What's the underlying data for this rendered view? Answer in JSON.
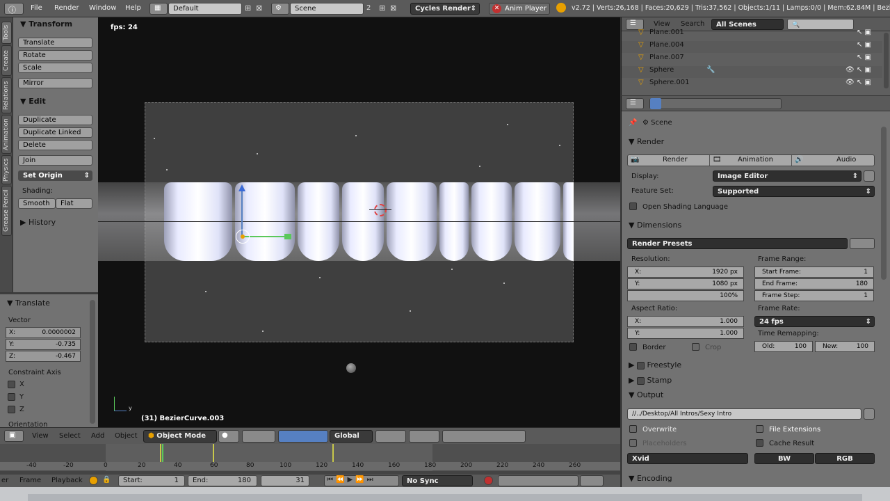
{
  "topbar": {
    "menus": [
      "File",
      "Render",
      "Window",
      "Help"
    ],
    "screen_layout": "Default",
    "scene": "Scene",
    "scene_count": "2",
    "engine": "Cycles Render",
    "anim_player": "Anim Player",
    "stats": "v2.72 | Verts:26,168 | Faces:20,629 | Tris:37,562 | Objects:1/11 | Lamps:0/0 | Mem:62.84M | BezierC"
  },
  "tabs": [
    "Tools",
    "Create",
    "Relations",
    "Animation",
    "Physics",
    "Grease Pencil"
  ],
  "tool_panel": {
    "transform": {
      "title": "Transform",
      "buttons": [
        "Translate",
        "Rotate",
        "Scale"
      ],
      "mirror": "Mirror"
    },
    "edit": {
      "title": "Edit",
      "buttons": [
        "Duplicate",
        "Duplicate Linked",
        "Delete"
      ],
      "join": "Join",
      "set_origin": "Set Origin",
      "shading_label": "Shading:",
      "smooth": "Smooth",
      "flat": "Flat"
    },
    "history": "History"
  },
  "operator_panel": {
    "title": "Translate",
    "vector_label": "Vector",
    "x_label": "X:",
    "x_value": "0.0000002",
    "y_label": "Y:",
    "y_value": "-0.735",
    "z_label": "Z:",
    "z_value": "-0.467",
    "constraint_label": "Constraint Axis",
    "axes": [
      "X",
      "Y",
      "Z"
    ],
    "orientation": "Orientation"
  },
  "viewport": {
    "fps": "fps: 24",
    "object_info": "(31) BezierCurve.003",
    "axis_y": "y"
  },
  "view_header": {
    "view": "View",
    "select": "Select",
    "add": "Add",
    "object": "Object",
    "mode": "Object Mode",
    "orientation": "Global"
  },
  "timeline": {
    "ruler": [
      "-40",
      "-20",
      "0",
      "20",
      "40",
      "60",
      "80",
      "100",
      "120",
      "140",
      "160",
      "180",
      "200",
      "220",
      "240",
      "260"
    ],
    "menu_er": "er",
    "frame": "Frame",
    "playback": "Playback",
    "start_label": "Start:",
    "start": "1",
    "end_label": "End:",
    "end": "180",
    "current": "31",
    "sync": "No Sync",
    "current_frame": 31
  },
  "outliner": {
    "view": "View",
    "search": "Search",
    "scenes": "All Scenes",
    "items": [
      "Plane.001",
      "Plane.004",
      "Plane.007",
      "Sphere",
      "Sphere.001"
    ]
  },
  "properties": {
    "context": "Scene",
    "render": {
      "title": "Render",
      "render_btn": "Render",
      "animation_btn": "Animation",
      "audio_btn": "Audio",
      "display_label": "Display:",
      "display": "Image Editor",
      "feature_label": "Feature Set:",
      "feature": "Supported",
      "osl": "Open Shading Language"
    },
    "dimensions": {
      "title": "Dimensions",
      "presets": "Render Presets",
      "resolution_label": "Resolution:",
      "res_x_label": "X:",
      "res_x": "1920 px",
      "res_y_label": "Y:",
      "res_y": "1080 px",
      "res_pct": "100%",
      "aspect_label": "Aspect Ratio:",
      "asp_x_label": "X:",
      "asp_x": "1.000",
      "asp_y_label": "Y:",
      "asp_y": "1.000",
      "border": "Border",
      "crop": "Crop",
      "frame_range_label": "Frame Range:",
      "start_frame_label": "Start Frame:",
      "start_frame": "1",
      "end_frame_label": "End Frame:",
      "end_frame": "180",
      "frame_step_label": "Frame Step:",
      "frame_step": "1",
      "frame_rate_label": "Frame Rate:",
      "frame_rate": "24 fps",
      "time_remap_label": "Time Remapping:",
      "old_label": "Old:",
      "old": "100",
      "new_label": "New:",
      "new": "100"
    },
    "freestyle": "Freestyle",
    "stamp": "Stamp",
    "output": {
      "title": "Output",
      "path": "//../Desktop/All Intros/Sexy Intro",
      "overwrite": "Overwrite",
      "file_extensions": "File Extensions",
      "placeholders": "Placeholders",
      "cache_result": "Cache Result",
      "format": "Xvid",
      "bw": "BW",
      "rgb": "RGB"
    },
    "encoding": "Encoding"
  },
  "colors": {
    "accent_blue": "#5680c2",
    "playhead": "#5ac85a"
  }
}
